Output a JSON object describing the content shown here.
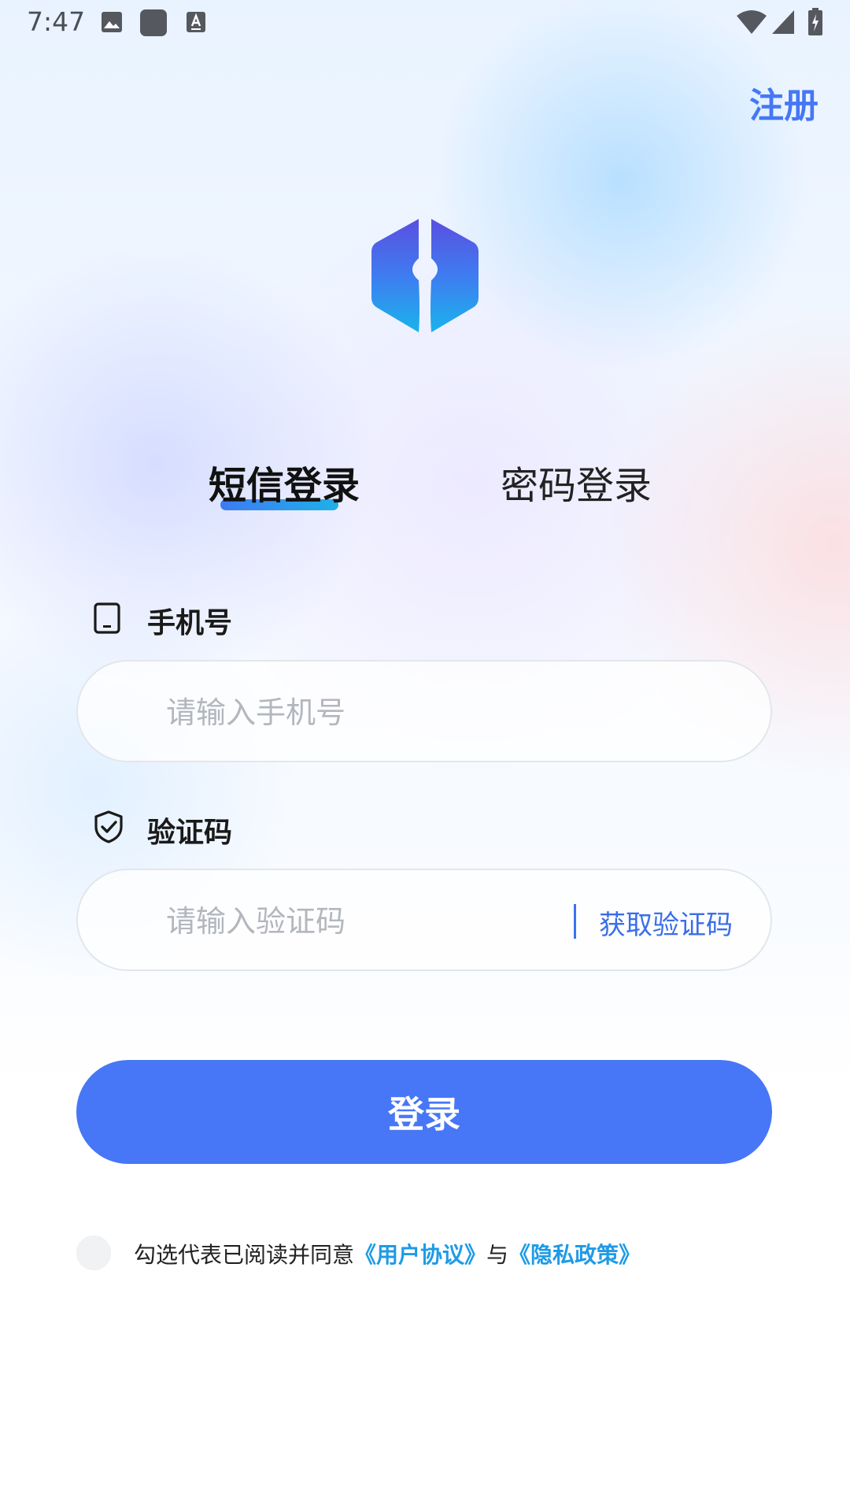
{
  "status_bar": {
    "time": "7:47",
    "icons": [
      "image-icon",
      "app-square-icon",
      "text-a-icon",
      "wifi-icon",
      "signal-icon",
      "battery-charging-icon"
    ]
  },
  "header": {
    "register_label": "注册"
  },
  "tabs": {
    "sms_label": "短信登录",
    "password_label": "密码登录",
    "active": "sms"
  },
  "phone": {
    "label": "手机号",
    "placeholder": "请输入手机号",
    "value": ""
  },
  "code": {
    "label": "验证码",
    "placeholder": "请输入验证码",
    "value": "",
    "get_code_label": "获取验证码"
  },
  "login_button": "登录",
  "agreement": {
    "checked": false,
    "prefix": "勾选代表已阅读并同意",
    "user_agreement": "《用户协议》",
    "conjunction": "与",
    "privacy_policy": "《隐私政策》"
  },
  "colors": {
    "primary": "#4777f6",
    "link": "#1e9be6",
    "register": "#4577f6"
  }
}
